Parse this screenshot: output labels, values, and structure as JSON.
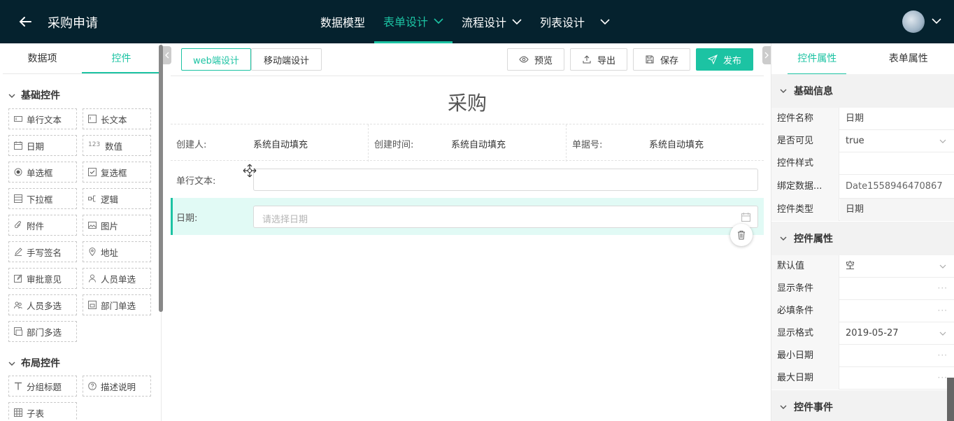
{
  "app": {
    "title": "采购申请"
  },
  "topnav": [
    {
      "label": "数据模型",
      "active": false,
      "dropdown": false
    },
    {
      "label": "表单设计",
      "active": true,
      "dropdown": true
    },
    {
      "label": "流程设计",
      "active": false,
      "dropdown": true
    },
    {
      "label": "列表设计",
      "active": false,
      "dropdown": true
    }
  ],
  "colors": {
    "accent": "#1cc3a3",
    "topbar": "#05222e"
  },
  "left_tabs": {
    "data_items": "数据项",
    "controls": "控件"
  },
  "basic_section": "基础控件",
  "basic_controls": [
    {
      "label": "单行文本",
      "icon": "single-line-text-icon"
    },
    {
      "label": "长文本",
      "icon": "long-text-icon"
    },
    {
      "label": "日期",
      "icon": "date-icon"
    },
    {
      "label": "数值",
      "icon": "number-icon",
      "glyph": "123"
    },
    {
      "label": "单选框",
      "icon": "radio-icon"
    },
    {
      "label": "复选框",
      "icon": "checkbox-icon"
    },
    {
      "label": "下拉框",
      "icon": "dropdown-icon"
    },
    {
      "label": "逻辑",
      "icon": "logic-icon"
    },
    {
      "label": "附件",
      "icon": "attachment-icon"
    },
    {
      "label": "图片",
      "icon": "image-icon"
    },
    {
      "label": "手写签名",
      "icon": "signature-icon"
    },
    {
      "label": "地址",
      "icon": "location-icon"
    },
    {
      "label": "审批意见",
      "icon": "approval-comment-icon"
    },
    {
      "label": "人员单选",
      "icon": "user-single-icon"
    },
    {
      "label": "人员多选",
      "icon": "users-multi-icon"
    },
    {
      "label": "部门单选",
      "icon": "department-single-icon"
    },
    {
      "label": "部门多选",
      "icon": "department-multi-icon"
    }
  ],
  "layout_section": "布局控件",
  "layout_controls": [
    {
      "label": "分组标题",
      "icon": "group-title-icon"
    },
    {
      "label": "描述说明",
      "icon": "description-icon"
    },
    {
      "label": "子表",
      "icon": "subtable-icon"
    }
  ],
  "toolbar": {
    "web_design": "web端设计",
    "mobile_design": "移动端设计",
    "preview": "预览",
    "export": "导出",
    "save": "保存",
    "publish": "发布"
  },
  "form": {
    "title": "采购",
    "info": [
      {
        "label": "创建人:",
        "value": "系统自动填充"
      },
      {
        "label": "创建时间:",
        "value": "系统自动填充"
      },
      {
        "label": "单据号:",
        "value": "系统自动填充"
      }
    ],
    "text_field": {
      "label": "单行文本:",
      "value": ""
    },
    "date_field": {
      "label": "日期:",
      "placeholder": "请选择日期"
    }
  },
  "right_tabs": {
    "control_props": "控件属性",
    "form_props": "表单属性"
  },
  "basic_info": {
    "title": "基础信息",
    "rows": [
      {
        "label": "控件名称",
        "value": "日期",
        "kind": "text"
      },
      {
        "label": "是否可见",
        "value": "true",
        "kind": "select"
      },
      {
        "label": "控件样式",
        "value": "",
        "kind": "text"
      },
      {
        "label": "绑定数据...",
        "value": "Date1558946470867",
        "kind": "text"
      },
      {
        "label": "控件类型",
        "value": "日期",
        "kind": "readonly"
      }
    ]
  },
  "control_props": {
    "title": "控件属性",
    "rows": [
      {
        "label": "默认值",
        "value": "空",
        "kind": "select"
      },
      {
        "label": "显示条件",
        "value": "",
        "kind": "more"
      },
      {
        "label": "必填条件",
        "value": "",
        "kind": "more"
      },
      {
        "label": "显示格式",
        "value": "2019-05-27",
        "kind": "select"
      },
      {
        "label": "最小日期",
        "value": "",
        "kind": "more"
      },
      {
        "label": "最大日期",
        "value": "",
        "kind": "more"
      }
    ]
  },
  "control_events": {
    "title": "控件事件"
  }
}
